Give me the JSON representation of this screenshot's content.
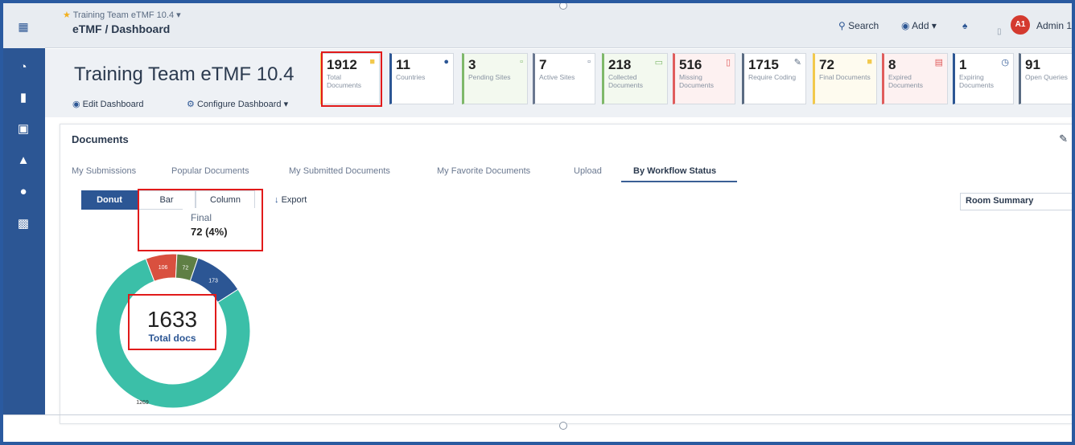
{
  "topbar": {
    "project_small": "Training Team eTMF 10.4",
    "breadcrumb": "eTMF / Dashboard",
    "search_label": "Search",
    "add_label": "Add",
    "avatar_initials": "A1",
    "user_name": "Admin 1"
  },
  "header": {
    "title": "Training Team eTMF 10.4",
    "edit_link": "Edit Dashboard",
    "configure_link": "Configure Dashboard"
  },
  "stats": [
    {
      "value": "1912",
      "label": "Total Documents",
      "color": "#f2c94c"
    },
    {
      "value": "11",
      "label": "Countries",
      "color": "#2c5694"
    },
    {
      "value": "3",
      "label": "Pending Sites",
      "color": "#7fb86a"
    },
    {
      "value": "7",
      "label": "Active Sites",
      "color": "#6a7890"
    },
    {
      "value": "218",
      "label": "Collected Documents",
      "color": "#7fb86a"
    },
    {
      "value": "516",
      "label": "Missing Documents",
      "color": "#e05d5d"
    },
    {
      "value": "1715",
      "label": "Require Coding",
      "color": "#5a6b82"
    },
    {
      "value": "72",
      "label": "Final Documents",
      "color": "#f2c94c"
    },
    {
      "value": "8",
      "label": "Expired Documents",
      "color": "#e05d5d"
    },
    {
      "value": "1",
      "label": "Expiring Documents",
      "color": "#2c5694"
    },
    {
      "value": "91",
      "label": "Open Queries",
      "color": "#5a6b82"
    }
  ],
  "panel": {
    "title": "Documents",
    "tabs": [
      "My Submissions",
      "Popular Documents",
      "My Submitted Documents",
      "My Favorite Documents",
      "Upload",
      "By Workflow Status"
    ],
    "active_tab": "By Workflow Status",
    "chart_types": [
      "Donut",
      "Bar",
      "Column"
    ],
    "selected_chart_type": "Donut",
    "export_label": "Export",
    "room_select": "Room Summary",
    "tooltip": {
      "name": "Final",
      "value": "72 (4%)"
    },
    "total_value": "1633",
    "total_label": "Total docs"
  },
  "chart_data": {
    "type": "pie",
    "series": [
      {
        "value": 1269,
        "color": "#3bbfa8"
      },
      {
        "value": 106,
        "color": "#d9503f"
      },
      {
        "value": 72,
        "color": "#5f7f45"
      },
      {
        "value": 173,
        "color": "#2c5694"
      }
    ],
    "labels": [
      "1269",
      "106",
      "72",
      "173"
    ],
    "center_value": "1633",
    "center_label": "Total docs"
  }
}
